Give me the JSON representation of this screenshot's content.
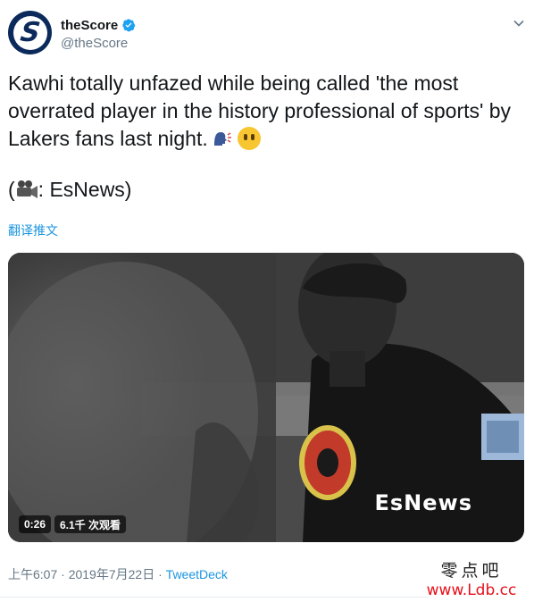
{
  "tweet": {
    "author": {
      "display_name": "theScore",
      "handle": "@theScore",
      "avatar_letter": "S",
      "verified": true
    },
    "text": "Kawhi totally unfazed while being called 'the most overrated player in the history professional of sports' by Lakers fans last night.",
    "credit_text": ": EsNews)",
    "credit_open": "(",
    "translate_label": "翻译推文",
    "video": {
      "watermark": "EsNews",
      "duration": "0:26",
      "views": "6.1千 次观看"
    },
    "meta": {
      "time": "上午6:07",
      "separator": "·",
      "date": "2019年7月22日",
      "separator2": "·",
      "source": "TweetDeck"
    }
  },
  "site_logo": {
    "cn": "零点吧",
    "url": "www.Ldb.cc"
  },
  "icons": {
    "verified": "verified-badge-icon",
    "caret": "chevron-down-icon",
    "speaking": "speaking-head-emoji",
    "face": "face-without-mouth-emoji",
    "camera": "movie-camera-emoji"
  },
  "colors": {
    "link": "#1b95e0",
    "secondary": "#657786",
    "brand_navy": "#0b2a5b",
    "watermark_red": "#e8101b"
  }
}
